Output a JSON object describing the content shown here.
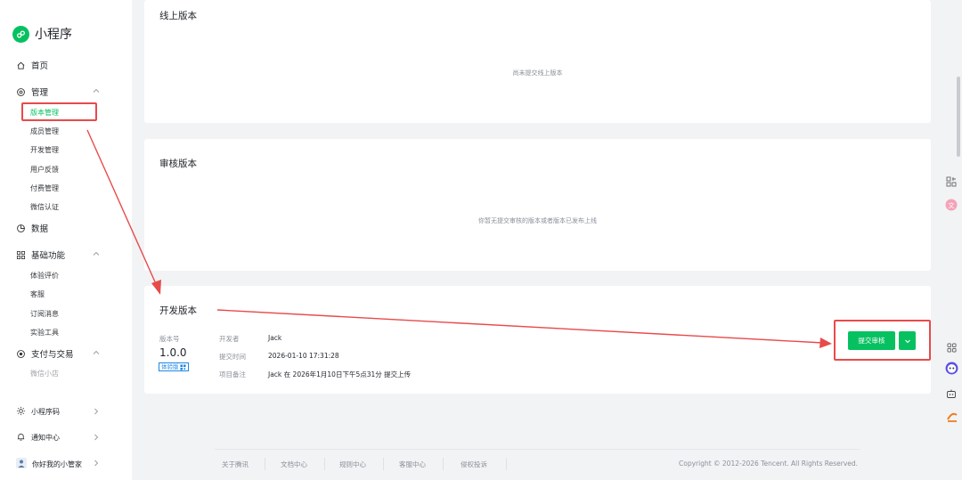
{
  "app": {
    "name": "小程序"
  },
  "sidebar": {
    "home": "首页",
    "manage": "管理",
    "manage_items": [
      "版本管理",
      "成员管理",
      "开发管理",
      "用户反馈",
      "付费管理",
      "微信认证"
    ],
    "data": "数据",
    "basic": "基础功能",
    "basic_items": [
      "体验评价",
      "客服",
      "订阅消息",
      "实验工具"
    ],
    "pay": "支付与交易",
    "pay_items": [
      "微信小店"
    ],
    "bottom": [
      "小程序码",
      "通知中心",
      "你好我的小管家"
    ]
  },
  "online": {
    "title": "线上版本",
    "empty": "尚未提交线上版本"
  },
  "review": {
    "title": "审核版本",
    "empty": "你暂无提交审核的版本或者版本已发布上线"
  },
  "dev": {
    "title": "开发版本",
    "version_label": "版本号",
    "version": "1.0.0",
    "badge": "体验版",
    "developer_label": "开发者",
    "developer": "Jack",
    "time_label": "提交时间",
    "time": "2026-01-10 17:31:28",
    "note_label": "项目备注",
    "note": "Jack 在 2026年1月10日下午5点31分 提交上传",
    "submit": "提交审核"
  },
  "footer": {
    "links": [
      "关于腾讯",
      "文档中心",
      "规则中心",
      "客服中心",
      "侵权投诉"
    ],
    "copyright": "Copyright © 2012-2026 Tencent. All Rights Reserved."
  },
  "colors": {
    "accent": "#07c160",
    "annotation": "#e84a4a"
  },
  "icons": [
    "home-icon",
    "manage-icon",
    "data-icon",
    "grid-icon",
    "pay-icon",
    "qrcode-icon",
    "bell-icon",
    "avatar-icon"
  ]
}
